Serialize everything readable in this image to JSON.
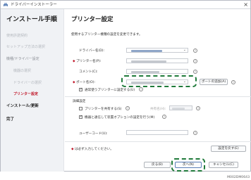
{
  "window": {
    "title": "ドライバーインストーラー",
    "close_glyph": "×"
  },
  "sidebar": {
    "title": "インストール手順",
    "items": [
      {
        "label": "使用許諾契約",
        "state": "done"
      },
      {
        "label": "セットアップ方法の選択",
        "state": "done"
      },
      {
        "label": "機種/ドライバー設定",
        "state": "parent"
      },
      {
        "label": "機器の選択",
        "state": "done"
      },
      {
        "label": "ドライバーの選択",
        "state": "done"
      },
      {
        "label": "プリンター設定",
        "state": "active"
      },
      {
        "label": "インストール/更新",
        "state": "step"
      },
      {
        "label": "完了",
        "state": "step"
      }
    ]
  },
  "main": {
    "title": "プリンター設定",
    "description": "使用するプリンター機種の設定を変更できます。",
    "fields": {
      "driver_name_label": "ドライバー名(D):",
      "printer_name_label": "プリンター名(P):",
      "comment_label": "コメント(C):",
      "port_label": "ポート名(O):"
    },
    "add_port_button": "ポートの追加(A)",
    "default_printer_label": "通常使うプリンターに設定する(U)",
    "detail_heading": "詳細設定",
    "share_printer_label": "プリンターを共有する(S)",
    "share_name_label": "共有名(H):",
    "auto_option_label": "機器と通信して装置オプションの設定を行う(M)",
    "user_code_label": "ユーザーコード(U):",
    "required_note": "は必ず入力してください。",
    "restore_button": "設定を戻す(E)",
    "back_button": "戻る(B)",
    "next_button": "次へ(N)",
    "cancel_button": "キャンセル(C)"
  },
  "image_code": "M002DM0643",
  "colors": {
    "accent_red": "#c0182a",
    "highlight_green": "#1f7a3a",
    "sidebar_bg": "#f0f2f5"
  }
}
